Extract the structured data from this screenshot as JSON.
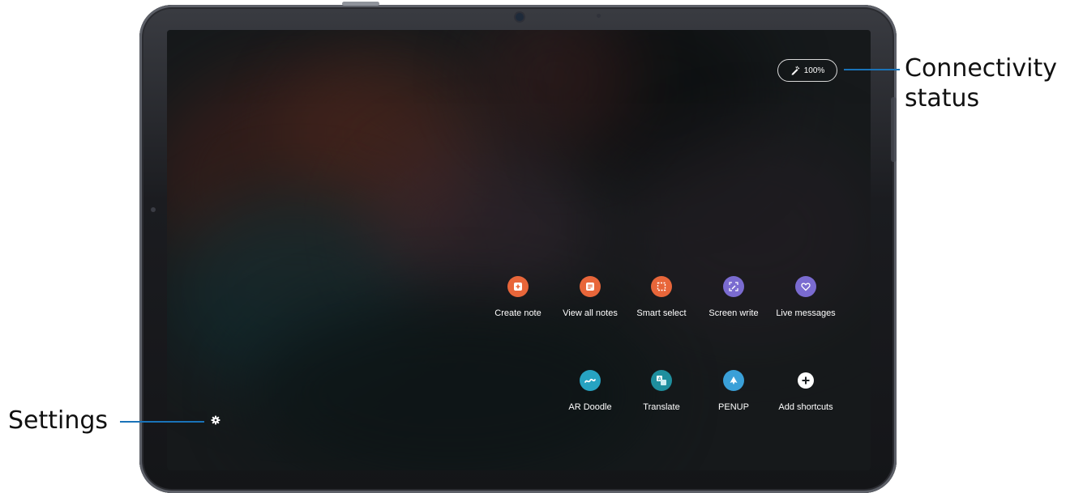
{
  "status_bar": {
    "battery_percent": "100%",
    "pen_icon": "s-pen-icon"
  },
  "shortcuts_row1": [
    {
      "label": "Create note",
      "icon": "create-note-icon",
      "color": "#e8663a"
    },
    {
      "label": "View all notes",
      "icon": "view-all-notes-icon",
      "color": "#e8663a"
    },
    {
      "label": "Smart select",
      "icon": "smart-select-icon",
      "color": "#e8663a"
    },
    {
      "label": "Screen write",
      "icon": "screen-write-icon",
      "color": "#7a6bd0"
    },
    {
      "label": "Live messages",
      "icon": "live-messages-icon",
      "color": "#7a6bd0"
    }
  ],
  "shortcuts_row2": [
    {
      "label": "AR Doodle",
      "icon": "ar-doodle-icon",
      "color": "#27a3c2"
    },
    {
      "label": "Translate",
      "icon": "translate-icon",
      "color": "#1f8f9e"
    },
    {
      "label": "PENUP",
      "icon": "penup-icon",
      "color": "#3aa0d8"
    },
    {
      "label": "Add shortcuts",
      "icon": "add-icon",
      "color": "#ffffff"
    }
  ],
  "settings_icon": "gear-icon",
  "callouts": {
    "connectivity_line1": "Connectivity",
    "connectivity_line2": "status",
    "settings": "Settings"
  },
  "colors": {
    "callout_line": "#1a73b8",
    "orange_accent": "#e8663a",
    "purple_accent": "#7a6bd0"
  }
}
